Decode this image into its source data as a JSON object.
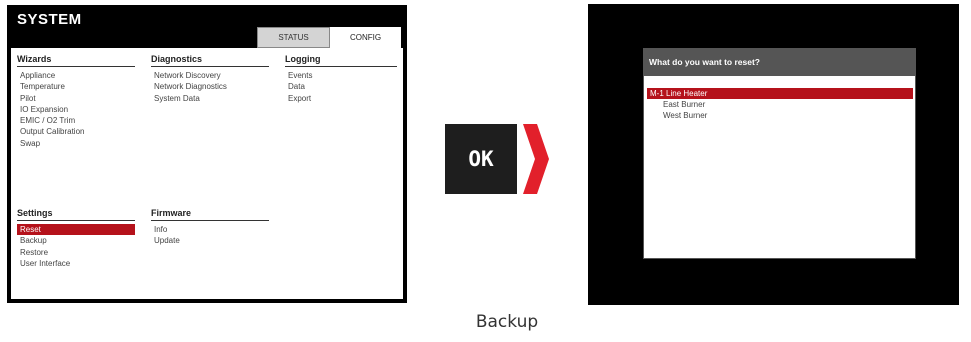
{
  "left": {
    "title": "SYSTEM",
    "tabs": [
      {
        "label": "STATUS"
      },
      {
        "label": "CONFIG",
        "active": true
      }
    ],
    "columns": {
      "wizards": {
        "heading": "Wizards",
        "items": [
          "Appliance",
          "Temperature",
          "Pilot",
          "IO Expansion",
          "EMIC / O2 Trim",
          "Output Calibration",
          "Swap"
        ]
      },
      "diagnostics": {
        "heading": "Diagnostics",
        "items": [
          "Network Discovery",
          "Network Diagnostics",
          "System Data"
        ]
      },
      "logging": {
        "heading": "Logging",
        "items": [
          "Events",
          "Data",
          "Export"
        ]
      },
      "settings": {
        "heading": "Settings",
        "items": [
          "Reset",
          "Backup",
          "Restore",
          "User Interface"
        ],
        "selected_index": 0
      },
      "firmware": {
        "heading": "Firmware",
        "items": [
          "Info",
          "Update"
        ]
      }
    }
  },
  "key": {
    "label": "OK",
    "arrow_color": "#e2202b"
  },
  "right": {
    "dialog_title": "What do you want to reset?",
    "selected_marker": "M-1",
    "options": [
      "Line Heater",
      "East Burner",
      "West Burner"
    ],
    "selected_index": 0
  },
  "caption": "Backup",
  "colors": {
    "accent": "#b5121b",
    "screen_bg": "#000000",
    "title_bar": "#555555"
  }
}
